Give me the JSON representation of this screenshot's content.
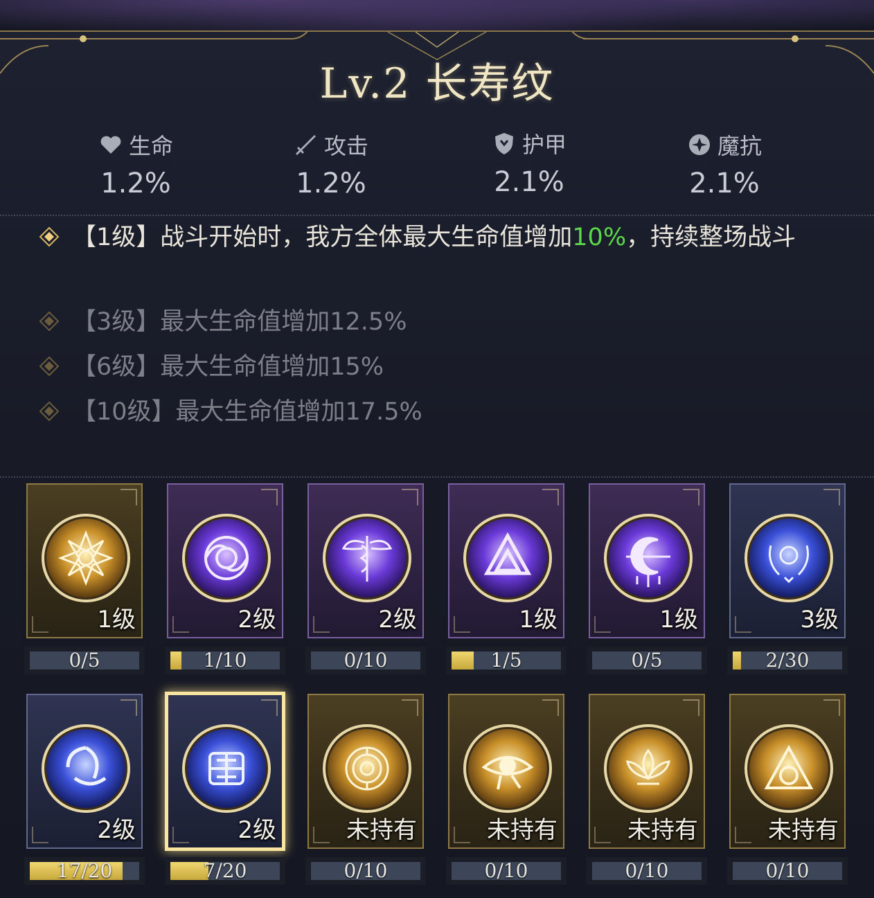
{
  "title": "Lv.2 长寿纹",
  "stats": [
    {
      "label": "生命",
      "value": "1.2%",
      "icon": "heart-icon"
    },
    {
      "label": "攻击",
      "value": "1.2%",
      "icon": "sword-icon"
    },
    {
      "label": "护甲",
      "value": "2.1%",
      "icon": "shield-icon"
    },
    {
      "label": "魔抗",
      "value": "2.1%",
      "icon": "magic-resist-icon"
    }
  ],
  "effects": [
    {
      "prefix": "【1级】战斗开始时，我方全体最大生命值增加",
      "highlight": "10%",
      "suffix": "，持续整场战斗",
      "active": true
    },
    {
      "prefix": "【3级】最大生命值增加12.5%",
      "highlight": "",
      "suffix": "",
      "active": false
    },
    {
      "prefix": "【6级】最大生命值增加15%",
      "highlight": "",
      "suffix": "",
      "active": false
    },
    {
      "prefix": "【10级】最大生命值增加17.5%",
      "highlight": "",
      "suffix": "",
      "active": false
    }
  ],
  "colors": {
    "highlight": "#5bd84a",
    "accent_gold": "#f0d770",
    "title": "#f1e6c4"
  },
  "runes": [
    {
      "icon": "golden-mandala-icon",
      "level": "1级",
      "progress": "0/5",
      "fill": 0.0,
      "rarity": "gold"
    },
    {
      "icon": "purple-vortex-icon",
      "level": "2级",
      "progress": "1/10",
      "fill": 0.1,
      "rarity": "purple"
    },
    {
      "icon": "caduceus-wings-icon",
      "level": "2级",
      "progress": "0/10",
      "fill": 0.0,
      "rarity": "purple"
    },
    {
      "icon": "valknut-icon",
      "level": "1级",
      "progress": "1/5",
      "fill": 0.2,
      "rarity": "purple"
    },
    {
      "icon": "crescent-dreamcatcher-icon",
      "level": "1级",
      "progress": "0/5",
      "fill": 0.0,
      "rarity": "purple"
    },
    {
      "icon": "moon-laurel-icon",
      "level": "3级",
      "progress": "2/30",
      "fill": 0.067,
      "rarity": "blue"
    },
    {
      "icon": "triple-moon-icon",
      "level": "2级",
      "progress": "17/20",
      "fill": 0.85,
      "rarity": "blue"
    },
    {
      "icon": "longevity-seal-icon",
      "level": "2级",
      "progress": "7/20",
      "fill": 0.35,
      "rarity": "blue",
      "selected": true
    },
    {
      "icon": "labyrinth-icon",
      "level": "未持有",
      "progress": "0/10",
      "fill": 0.0,
      "rarity": "gold"
    },
    {
      "icon": "eye-of-horus-icon",
      "level": "未持有",
      "progress": "0/10",
      "fill": 0.0,
      "rarity": "gold"
    },
    {
      "icon": "lotus-icon",
      "level": "未持有",
      "progress": "0/10",
      "fill": 0.0,
      "rarity": "gold"
    },
    {
      "icon": "triangle-circle-icon",
      "level": "未持有",
      "progress": "0/10",
      "fill": 0.0,
      "rarity": "gold"
    }
  ]
}
